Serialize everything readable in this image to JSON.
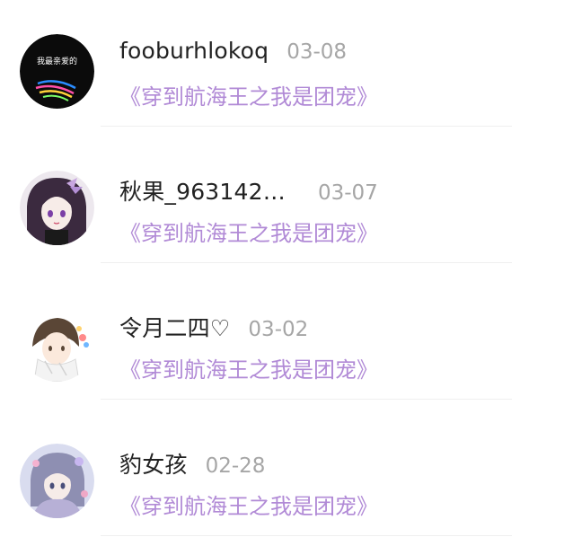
{
  "comments": [
    {
      "username": "fooburhlokoq",
      "date": "03-08",
      "book_title": "《穿到航海王之我是团宠》",
      "avatar_icon": "text-avatar-icon",
      "avatar_text": "我最亲爱的"
    },
    {
      "username": "秋果_963142…",
      "date": "03-07",
      "book_title": "《穿到航海王之我是团宠》",
      "avatar_icon": "anime-girl-avatar-icon"
    },
    {
      "username": "令月二四♡",
      "date": "03-02",
      "book_title": "《穿到航海王之我是团宠》",
      "avatar_icon": "anime-boy-avatar-icon"
    },
    {
      "username": "豹女孩",
      "date": "02-28",
      "book_title": "《穿到航海王之我是团宠》",
      "avatar_icon": "anime-character-avatar-icon"
    }
  ],
  "colors": {
    "username": "#222222",
    "date": "#a6a6a6",
    "book_title": "#b18ad6",
    "divider": "#efefef"
  }
}
